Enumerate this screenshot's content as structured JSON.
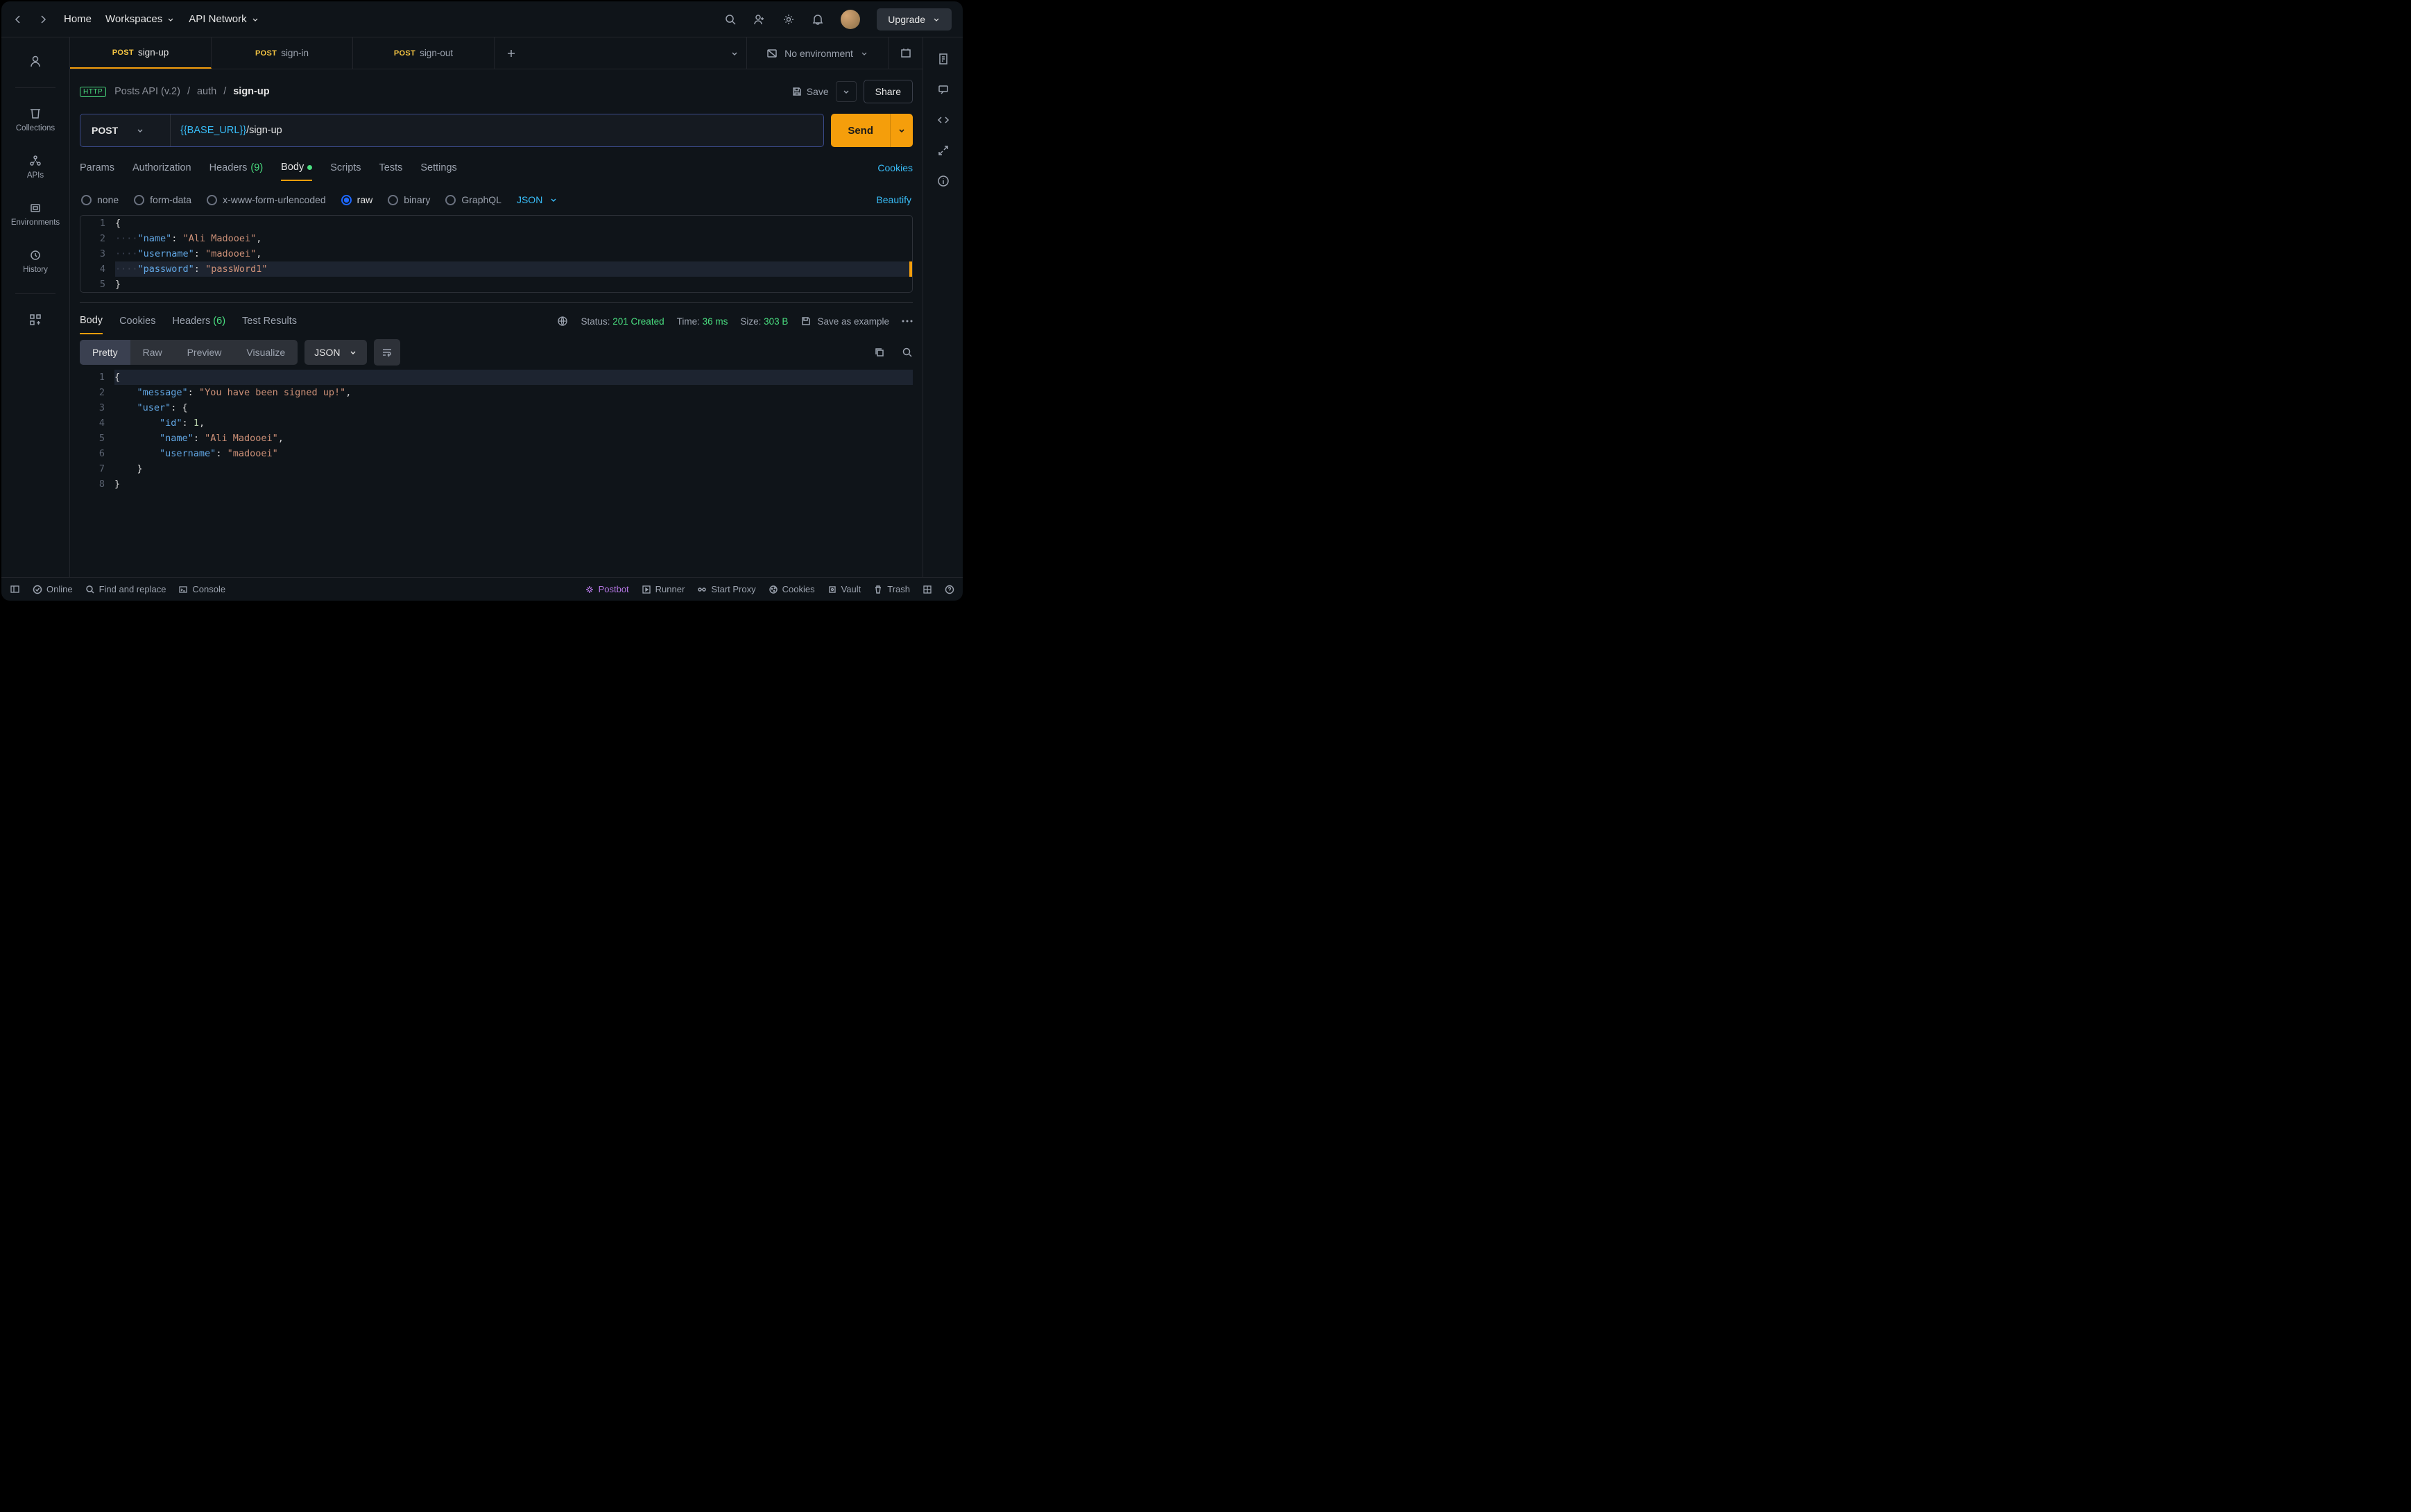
{
  "top": {
    "home": "Home",
    "workspaces": "Workspaces",
    "api_network": "API Network",
    "upgrade": "Upgrade"
  },
  "sidebar": {
    "collections": "Collections",
    "apis": "APIs",
    "environments": "Environments",
    "history": "History"
  },
  "tabs": [
    {
      "method": "POST",
      "name": "sign-up"
    },
    {
      "method": "POST",
      "name": "sign-in"
    },
    {
      "method": "POST",
      "name": "sign-out"
    }
  ],
  "env": {
    "label": "No environment"
  },
  "breadcrumb": {
    "collection": "Posts API (v.2)",
    "folder": "auth",
    "item": "sign-up"
  },
  "actions": {
    "save": "Save",
    "share": "Share"
  },
  "request": {
    "method": "POST",
    "url_var": "{{BASE_URL}}",
    "url_path": "/sign-up",
    "send": "Send"
  },
  "reqTabs": {
    "params": "Params",
    "authorization": "Authorization",
    "headers": "Headers",
    "headers_count": "(9)",
    "body": "Body",
    "scripts": "Scripts",
    "tests": "Tests",
    "settings": "Settings",
    "cookies": "Cookies"
  },
  "bodyTypes": {
    "none": "none",
    "form_data": "form-data",
    "urlencoded": "x-www-form-urlencoded",
    "raw": "raw",
    "binary": "binary",
    "graphql": "GraphQL",
    "json": "JSON",
    "beautify": "Beautify"
  },
  "bodyLines": [
    {
      "n": "1",
      "pre": "",
      "k": "",
      "v": "",
      "raw": "{"
    },
    {
      "n": "2",
      "pre": "····",
      "k": "\"name\"",
      "v": "\"Ali Madooei\"",
      "trail": ","
    },
    {
      "n": "3",
      "pre": "····",
      "k": "\"username\"",
      "v": "\"madooei\"",
      "trail": ","
    },
    {
      "n": "4",
      "pre": "····",
      "k": "\"password\"",
      "v": "\"passWord1\"",
      "trail": ""
    },
    {
      "n": "5",
      "pre": "",
      "k": "",
      "v": "",
      "raw": "}"
    }
  ],
  "respTabs": {
    "body": "Body",
    "cookies": "Cookies",
    "headers": "Headers",
    "headers_count": "(6)",
    "test_results": "Test Results"
  },
  "respMeta": {
    "status_label": "Status:",
    "status_value": "201 Created",
    "time_label": "Time:",
    "time_value": "36 ms",
    "size_label": "Size:",
    "size_value": "303 B",
    "save_example": "Save as example"
  },
  "respViews": {
    "pretty": "Pretty",
    "raw": "Raw",
    "preview": "Preview",
    "visualize": "Visualize",
    "format": "JSON"
  },
  "respLines": [
    {
      "n": "1",
      "html": "<span class='tok-p'>{</span>"
    },
    {
      "n": "2",
      "html": "    <span class='tok-k'>\"message\"</span><span class='tok-p'>: </span><span class='tok-s'>\"You have been signed up!\"</span><span class='tok-p'>,</span>"
    },
    {
      "n": "3",
      "html": "    <span class='tok-k'>\"user\"</span><span class='tok-p'>: {</span>"
    },
    {
      "n": "4",
      "html": "        <span class='tok-k'>\"id\"</span><span class='tok-p'>: </span><span class='tok-n'>1</span><span class='tok-p'>,</span>"
    },
    {
      "n": "5",
      "html": "        <span class='tok-k'>\"name\"</span><span class='tok-p'>: </span><span class='tok-s'>\"Ali Madooei\"</span><span class='tok-p'>,</span>"
    },
    {
      "n": "6",
      "html": "        <span class='tok-k'>\"username\"</span><span class='tok-p'>: </span><span class='tok-s'>\"madooei\"</span>"
    },
    {
      "n": "7",
      "html": "    <span class='tok-p'>}</span>"
    },
    {
      "n": "8",
      "html": "<span class='tok-p'>}</span>"
    }
  ],
  "footer": {
    "online": "Online",
    "find": "Find and replace",
    "console": "Console",
    "postbot": "Postbot",
    "runner": "Runner",
    "proxy": "Start Proxy",
    "cookies": "Cookies",
    "vault": "Vault",
    "trash": "Trash"
  }
}
